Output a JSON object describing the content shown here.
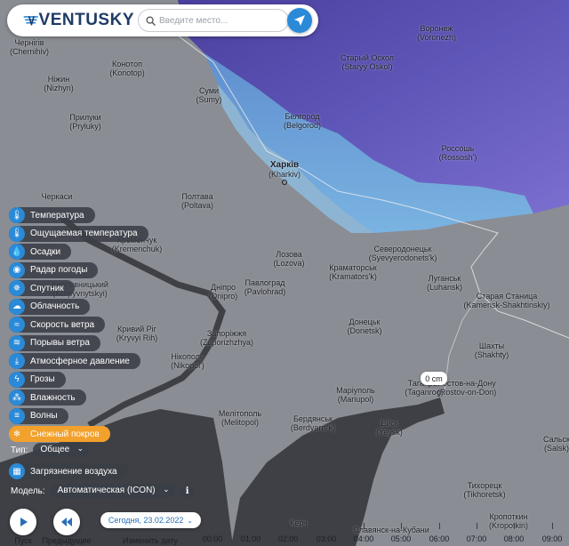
{
  "app": {
    "logo_text": "VENTUSKY",
    "brand_color": "#2a8ad8"
  },
  "search": {
    "placeholder": "Введите место..."
  },
  "cities": [
    {
      "name": "Чернігів",
      "latin": "(Chernihiv)"
    },
    {
      "name": "Ніжин",
      "latin": "(Nizhyn)"
    },
    {
      "name": "Конотоп",
      "latin": "(Konotop)"
    },
    {
      "name": "Прилуки",
      "latin": "(Pryluky)"
    },
    {
      "name": "Суми",
      "latin": "(Sumy)"
    },
    {
      "name": "Старый Оскол",
      "latin": "(Staryy Oskol)"
    },
    {
      "name": "Воронеж",
      "latin": "(Voronezh)"
    },
    {
      "name": "Белгород",
      "latin": "(Belgorod)"
    },
    {
      "name": "Россошь",
      "latin": "(Rossosh')"
    },
    {
      "name": "Харків",
      "latin": "(Kharkiv)"
    },
    {
      "name": "Полтава",
      "latin": "(Poltava)"
    },
    {
      "name": "Черкаси",
      "latin": ""
    },
    {
      "name": "Кременчук",
      "latin": "(Kremenchuk)"
    },
    {
      "name": "Лозова",
      "latin": "(Lozova)"
    },
    {
      "name": "Северодонецьк",
      "latin": "(Syevyerodonets'k)"
    },
    {
      "name": "Краматорськ",
      "latin": "(Kramators'k)"
    },
    {
      "name": "Кропивницький",
      "latin": "(Kropyvnytskyi)"
    },
    {
      "name": "Дніпро",
      "latin": "(Dnipro)"
    },
    {
      "name": "Павлоград",
      "latin": "(Pavlohrad)"
    },
    {
      "name": "Луганськ",
      "latin": "(Luhansk)"
    },
    {
      "name": "Старая Станица",
      "latin": "(Kamensk-Shakhtinskiy)"
    },
    {
      "name": "Донецьк",
      "latin": "(Donetsk)"
    },
    {
      "name": "Кривий Ріг",
      "latin": "(Kryvyi Rih)"
    },
    {
      "name": "Запоріжжя",
      "latin": "(Zaporizhzhya)"
    },
    {
      "name": "Шахты",
      "latin": "(Shakhty)"
    },
    {
      "name": "Нікополь",
      "latin": "(Nikopol')"
    },
    {
      "name": "Таганрог",
      "latin": "(Taganrog)"
    },
    {
      "name": "Ростов-на-Дону",
      "latin": "(Rostov-on-Don)"
    },
    {
      "name": "Маріуполь",
      "latin": "(Mariupol)"
    },
    {
      "name": "Мелітополь",
      "latin": "(Melitopol)"
    },
    {
      "name": "Бердянськ",
      "latin": "(Berdyans'k)"
    },
    {
      "name": "Ейск",
      "latin": "(Yeysk)"
    },
    {
      "name": "Тихорецк",
      "latin": "(Tikhoretsk)"
    },
    {
      "name": "Кропоткин",
      "latin": "(Kropotkin)"
    },
    {
      "name": "Сальск",
      "latin": "(Salsk)"
    },
    {
      "name": "Керч",
      "latin": ""
    },
    {
      "name": "Славянск-на-Кубани",
      "latin": ""
    }
  ],
  "layers": [
    {
      "label": "Температура",
      "icon": "thermometer-icon",
      "glyph": "🌡"
    },
    {
      "label": "Ощущаемая температура",
      "icon": "feels-like-icon",
      "glyph": "🌡"
    },
    {
      "label": "Осадки",
      "icon": "rain-drop-icon",
      "glyph": "💧"
    },
    {
      "label": "Радар погоды",
      "icon": "radar-icon",
      "glyph": "◉"
    },
    {
      "label": "Спутник",
      "icon": "satellite-icon",
      "glyph": "✵"
    },
    {
      "label": "Облачность",
      "icon": "cloud-icon",
      "glyph": "☁"
    },
    {
      "label": "Скорость ветра",
      "icon": "wind-speed-icon",
      "glyph": "≈"
    },
    {
      "label": "Порывы ветра",
      "icon": "wind-gust-icon",
      "glyph": "≋"
    },
    {
      "label": "Атмосферное давление",
      "icon": "pressure-icon",
      "glyph": "⤓"
    },
    {
      "label": "Грозы",
      "icon": "thunderstorm-icon",
      "glyph": "ϟ"
    },
    {
      "label": "Влажность",
      "icon": "humidity-icon",
      "glyph": "⁂"
    },
    {
      "label": "Волны",
      "icon": "waves-icon",
      "glyph": "≡"
    },
    {
      "label": "Снежный покров",
      "icon": "snowflake-icon",
      "glyph": "❄",
      "active": true
    }
  ],
  "type_select": {
    "label": "Тип:",
    "value": "Общее"
  },
  "pollution": {
    "label": "Загрязнение воздуха",
    "icon": "air-pollution-icon"
  },
  "model": {
    "label": "Модель:",
    "value": "Автоматическая (ICON)",
    "info": "i"
  },
  "controls": {
    "play_label": "Пуск",
    "previous_label": "Предыдущее",
    "change_date_label": "Изменить дату"
  },
  "date": {
    "value": "Сегодня, 23.02.2022"
  },
  "timeline": {
    "hours": [
      "00:00",
      "01:00",
      "02:00",
      "03:00",
      "04:00",
      "05:00",
      "06:00",
      "07:00",
      "08:00",
      "09:00"
    ]
  },
  "tooltip": {
    "value": "0 cm"
  },
  "colors": {
    "active_layer": "#f2a12c",
    "snow_deep": "#5a5fb8",
    "snow_light": "#6fb3e6",
    "land": "#8a8d93",
    "sea": "#3e4046"
  }
}
